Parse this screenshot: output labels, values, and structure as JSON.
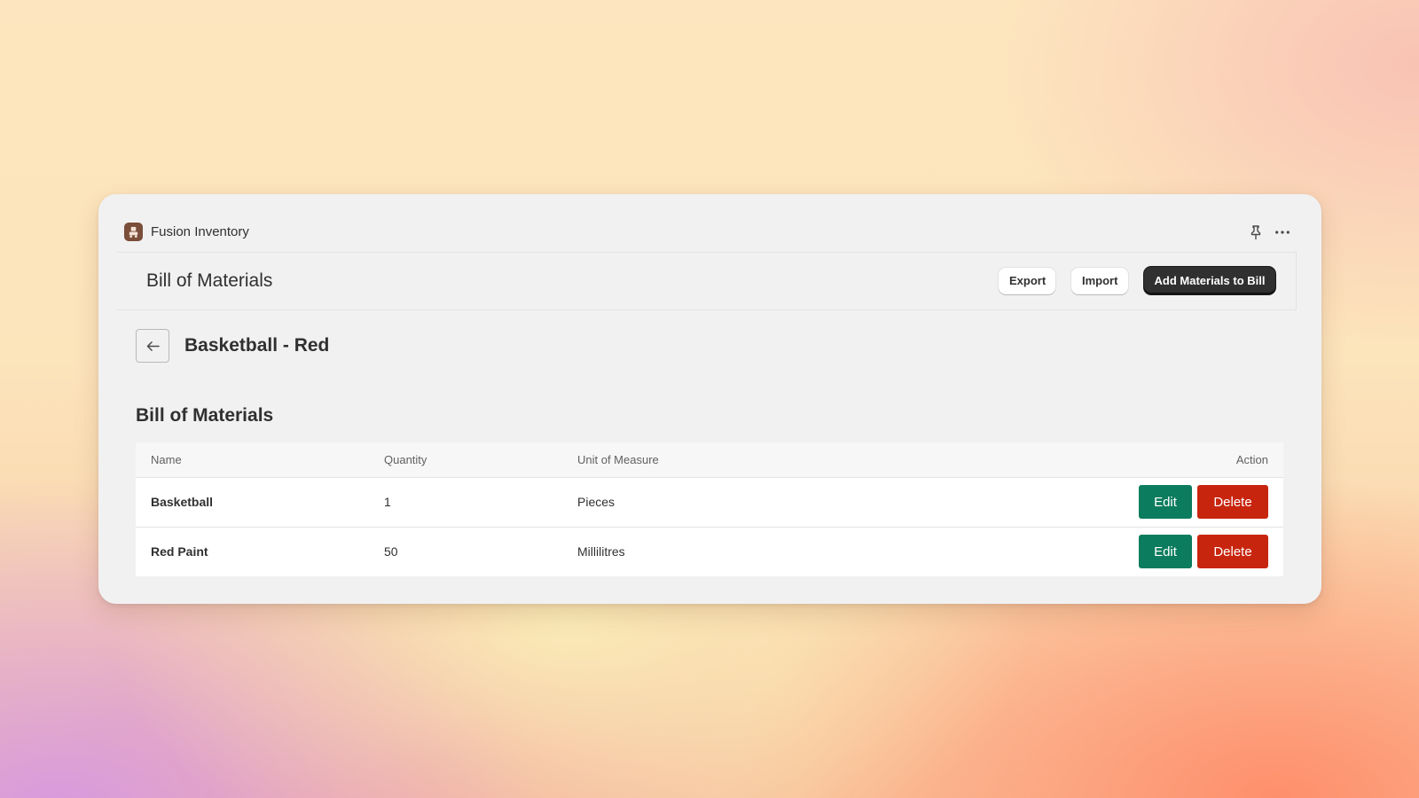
{
  "app": {
    "title": "Fusion Inventory",
    "logo_icon": "app-logo-icon",
    "colors": {
      "logo_bg": "#7a4e3a"
    }
  },
  "titlebar": {
    "pin_icon": "pin-icon",
    "more_icon": "more-horizontal-icon"
  },
  "header": {
    "title": "Bill of Materials",
    "export_label": "Export",
    "import_label": "Import",
    "add_label": "Add Materials to Bill",
    "colors": {
      "primary_button": "#303030"
    }
  },
  "product": {
    "back_icon": "arrow-left-icon",
    "title": "Basketball - Red"
  },
  "bom": {
    "section_title": "Bill of Materials",
    "columns": {
      "name": "Name",
      "quantity": "Quantity",
      "unit": "Unit of Measure",
      "action": "Action"
    },
    "rows": [
      {
        "name": "Basketball",
        "quantity": "1",
        "unit": "Pieces",
        "edit_label": "Edit",
        "delete_label": "Delete"
      },
      {
        "name": "Red Paint",
        "quantity": "50",
        "unit": "Millilitres",
        "edit_label": "Edit",
        "delete_label": "Delete"
      }
    ],
    "colors": {
      "edit": "#0b7c5d",
      "delete": "#c8250f"
    }
  }
}
